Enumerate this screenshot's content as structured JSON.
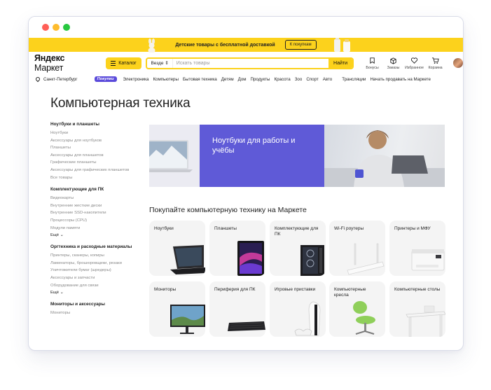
{
  "promo": {
    "text": "Детские товары с бесплатной доставкой",
    "button": "К покупкам"
  },
  "header": {
    "logo_bold": "Яндекс",
    "logo_rest": " Маркет",
    "catalog": "Каталог",
    "search_scope": "Везде ⇕",
    "search_placeholder": "Искать товары",
    "search_button": "Найти",
    "icons": [
      {
        "label": "Бонусы",
        "icon": "bonus-icon"
      },
      {
        "label": "Заказы",
        "icon": "box-icon"
      },
      {
        "label": "Избранное",
        "icon": "heart-icon"
      },
      {
        "label": "Корзина",
        "icon": "cart-icon"
      }
    ]
  },
  "nav": {
    "city": "Санкт-Петербург",
    "badge": "Покупки",
    "items": [
      "Электроника",
      "Компьютеры",
      "Бытовая техника",
      "Детям",
      "Дом",
      "Продукты",
      "Красота",
      "Зоо",
      "Спорт",
      "Авто",
      "Трансляции",
      "Начать продавать на Маркете"
    ]
  },
  "page_title": "Компьютерная техника",
  "sidebar": {
    "groups": [
      {
        "title": "Ноутбуки и планшеты",
        "items": [
          "Ноутбуки",
          "Аксессуары для ноутбуков",
          "Планшеты",
          "Аксессуары для планшетов",
          "Графические планшеты",
          "Аксессуары для графических планшетов",
          "Все товары"
        ]
      },
      {
        "title": "Комплектующие для ПК",
        "items": [
          "Видеокарты",
          "Внутренние жесткие диски",
          "Внутренние SSD-накопители",
          "Процессоры (CPU)",
          "Модули памяти"
        ],
        "more": "Ещё ⌄"
      },
      {
        "title": "Оргтехника и расходные материалы",
        "items": [
          "Принтеры, сканеры, копиры",
          "Ламинаторы, брошюровщики, резаки",
          "Уничтожители бумаг (шредеры)",
          "Аксессуары и запчасти",
          "Оборудование для связи"
        ],
        "more": "Ещё ⌄"
      },
      {
        "title": "Мониторы и аксессуары",
        "items": [
          "Мониторы"
        ]
      }
    ]
  },
  "banner": {
    "title": "Ноутбуки для работы и учёбы"
  },
  "section_title": "Покупайте компьютерную технику на Маркете",
  "cards": [
    {
      "label": "Ноутбуки",
      "icon": "laptop"
    },
    {
      "label": "Планшеты",
      "icon": "tablet"
    },
    {
      "label": "Комплектующие для ПК",
      "icon": "pc-case"
    },
    {
      "label": "Wi-Fi роутеры",
      "icon": "router"
    },
    {
      "label": "Принтеры и МФУ",
      "icon": "printer"
    },
    {
      "label": "Мониторы",
      "icon": "monitor"
    },
    {
      "label": "Периферия для ПК",
      "icon": "keyboard"
    },
    {
      "label": "Игровые приставки",
      "icon": "console"
    },
    {
      "label": "Компьютерные кресла",
      "icon": "chair"
    },
    {
      "label": "Компьютерные столы",
      "icon": "desk"
    }
  ],
  "colors": {
    "brand_yellow": "#fcd21c",
    "banner_blue": "#5f5ad7",
    "badge_purple": "#5b4bdb"
  }
}
